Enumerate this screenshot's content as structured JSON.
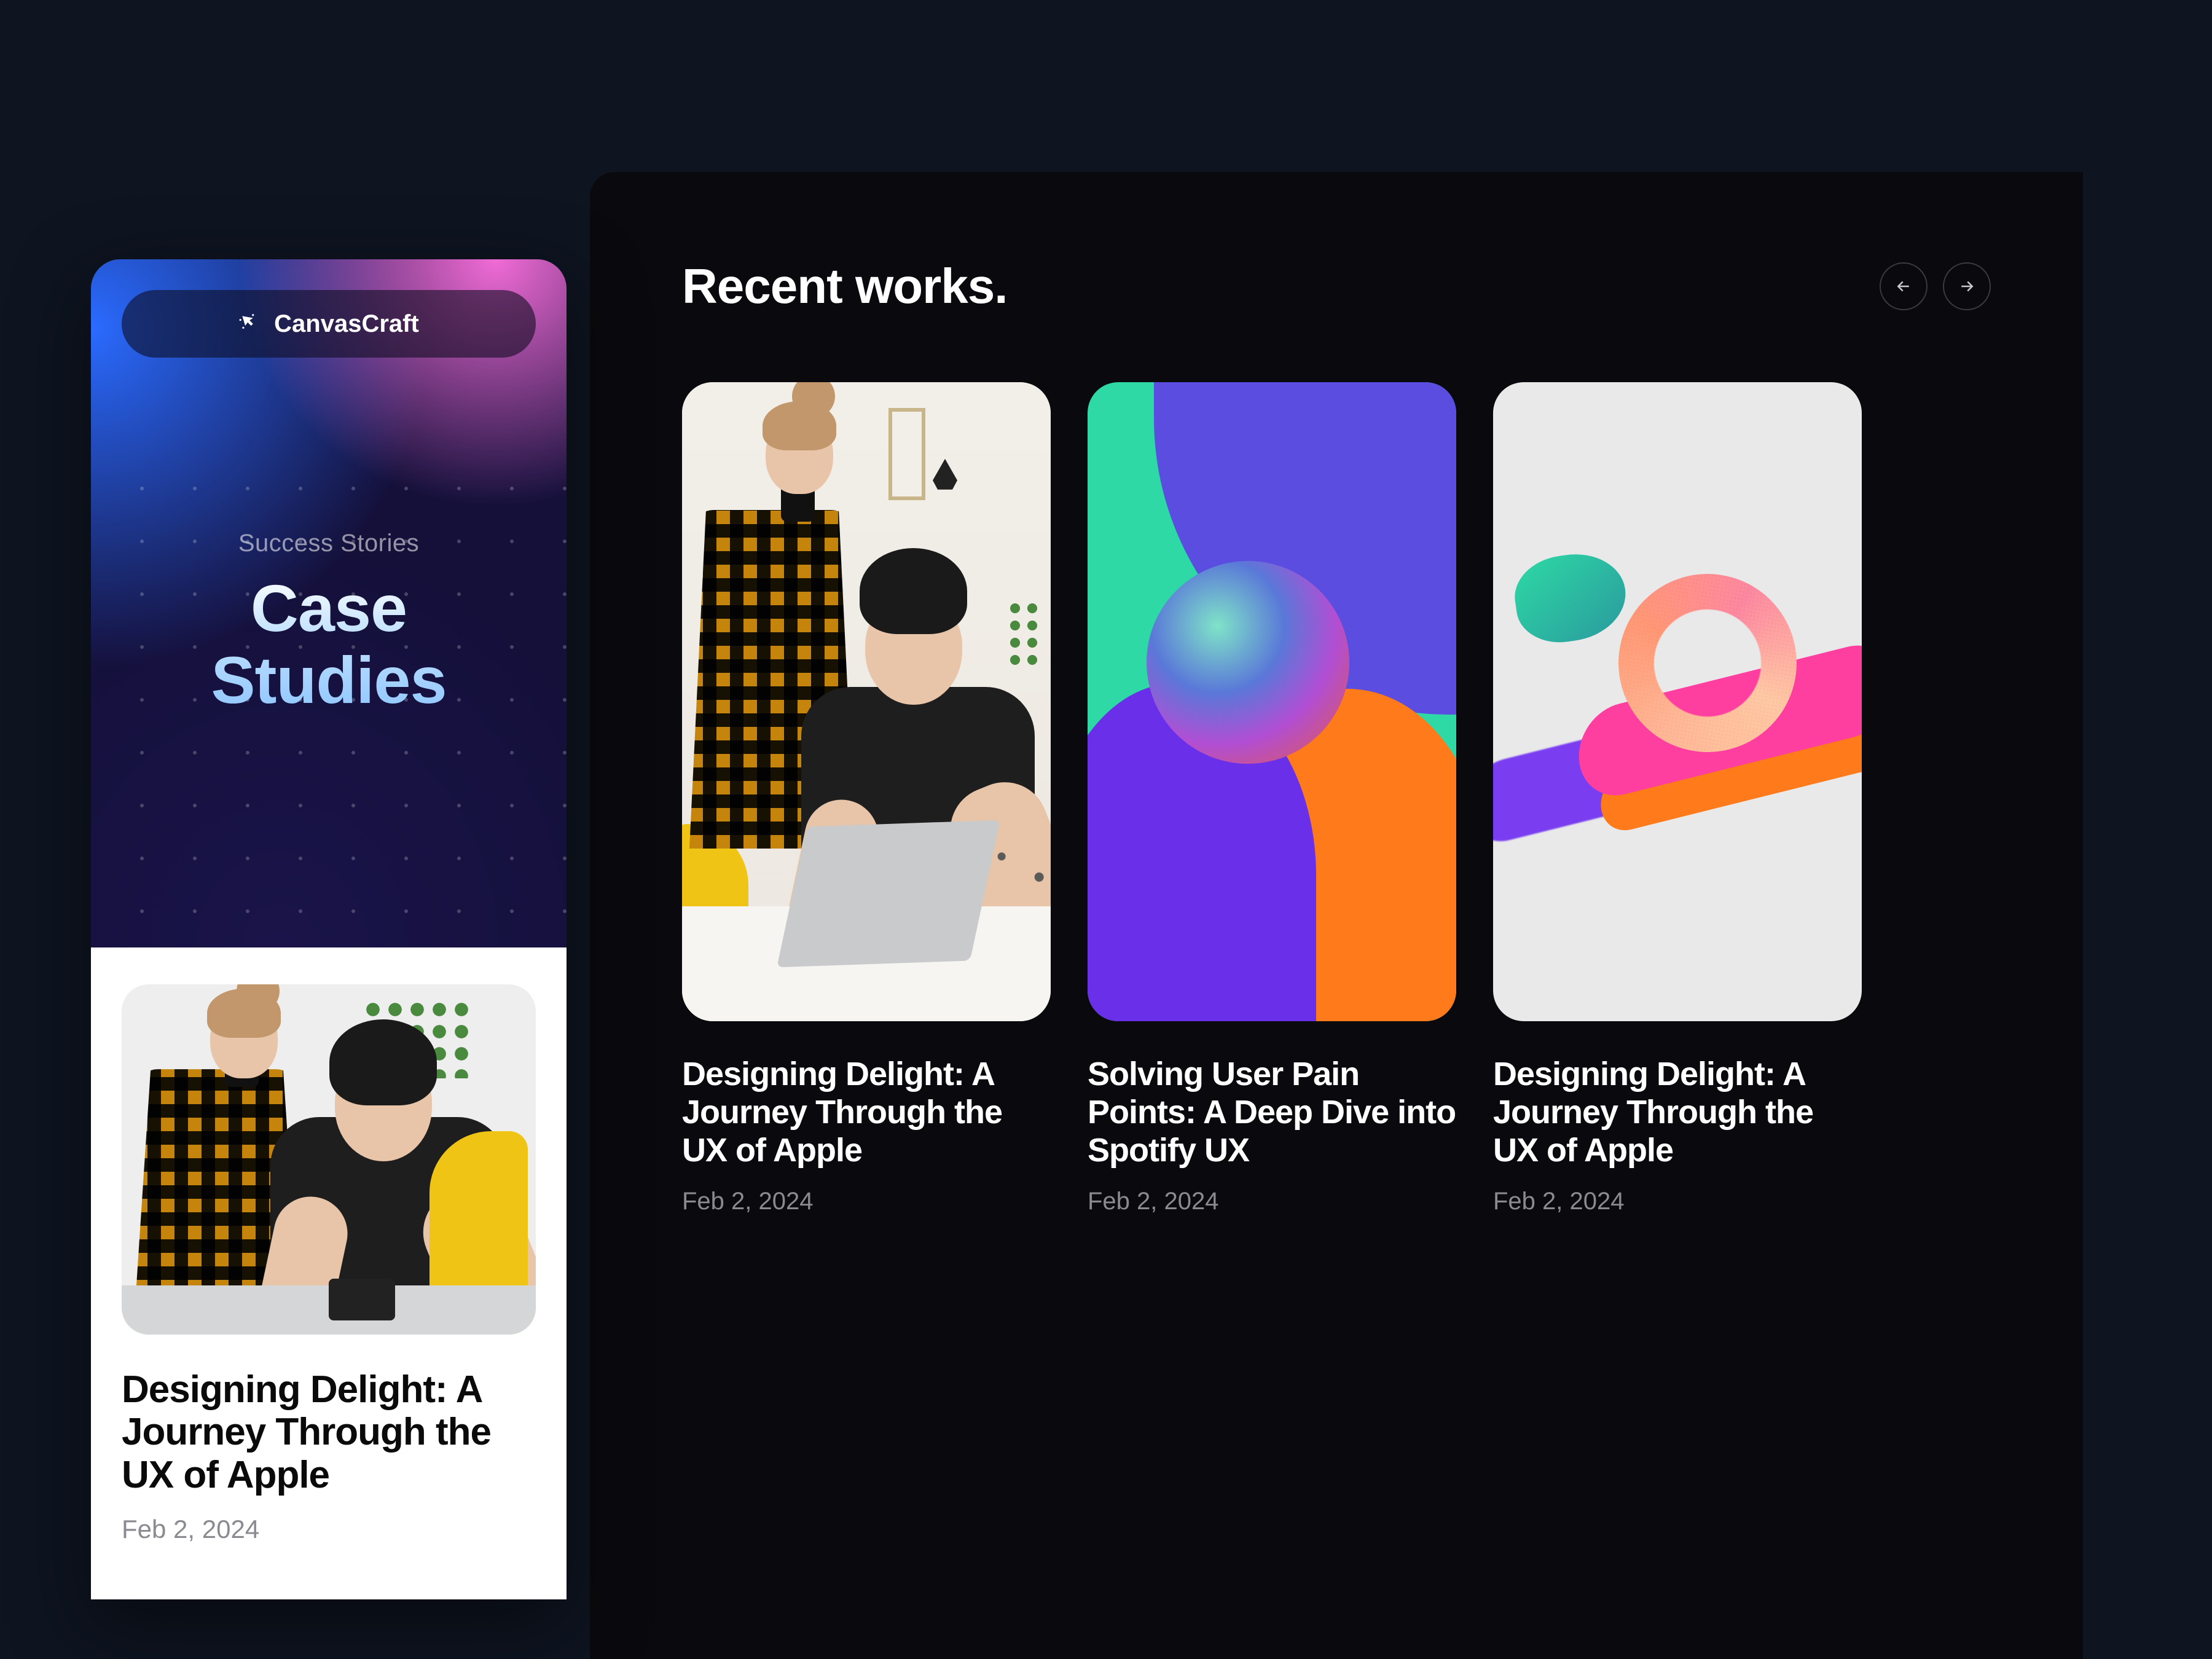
{
  "left": {
    "brand": "CanvasCraft",
    "eyebrow": "Success Stories",
    "title_line1": "Case",
    "title_line2": "Studies",
    "card": {
      "title": "Designing Delight: A Journey Through the UX of Apple",
      "date": "Feb 2, 2024"
    }
  },
  "right": {
    "heading": "Recent works.",
    "cards": [
      {
        "title": "Designing Delight: A Journey Through the UX of Apple",
        "date": "Feb 2, 2024"
      },
      {
        "title": "Solving User Pain Points: A Deep Dive into Spotify UX",
        "date": "Feb 2, 2024"
      },
      {
        "title": "Designing Delight: A Journey Through the UX of Apple",
        "date": "Feb 2, 2024"
      }
    ]
  }
}
